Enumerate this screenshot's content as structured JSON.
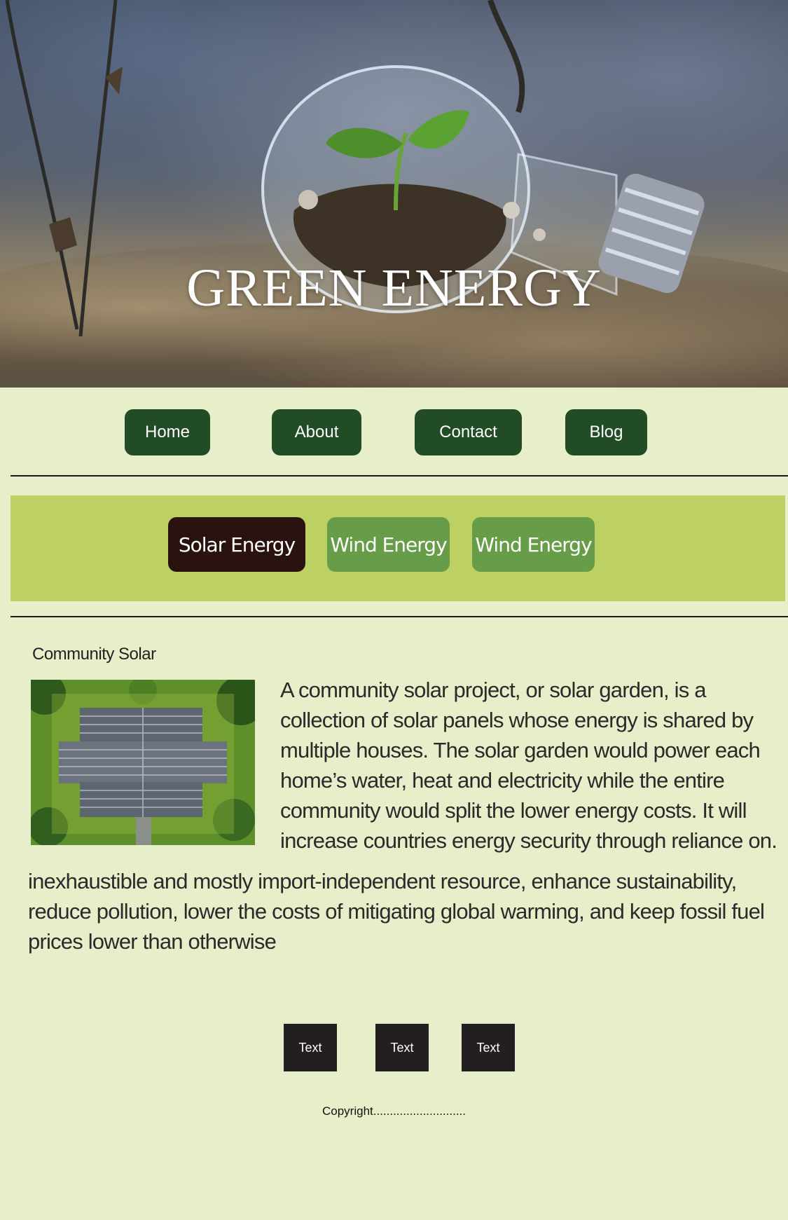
{
  "hero": {
    "title": "GREEN ENERGY"
  },
  "nav": {
    "items": [
      "Home",
      "About",
      "Contact",
      "Blog"
    ]
  },
  "tabs": [
    {
      "label": "Solar Energy",
      "active": true
    },
    {
      "label": "Wind Energy",
      "active": false
    },
    {
      "label": "Wind Energy",
      "active": false
    }
  ],
  "article": {
    "title": "Community Solar",
    "paragraph1": "A community solar project, or solar garden, is a collection of solar panels whose energy is shared by multiple houses. The solar garden would power each home’s water, heat and electricity while the entire community would split the lower energy costs. It will increase countries energy security through reliance on.",
    "paragraph2": "inexhaustible and mostly import-independent resource, enhance sustainability, reduce pollution, lower the costs of mitigating global warming, and keep fossil fuel prices lower than otherwise"
  },
  "footer": {
    "buttons": [
      "Text",
      "Text",
      "Text"
    ],
    "copyright": "Copyright............................"
  },
  "colors": {
    "background": "#e6efca",
    "nav_button": "#214c25",
    "tab_bar": "#bcd064",
    "tab_active": "#2a1211",
    "tab_inactive": "#679c49",
    "footer_button": "#231f20"
  }
}
